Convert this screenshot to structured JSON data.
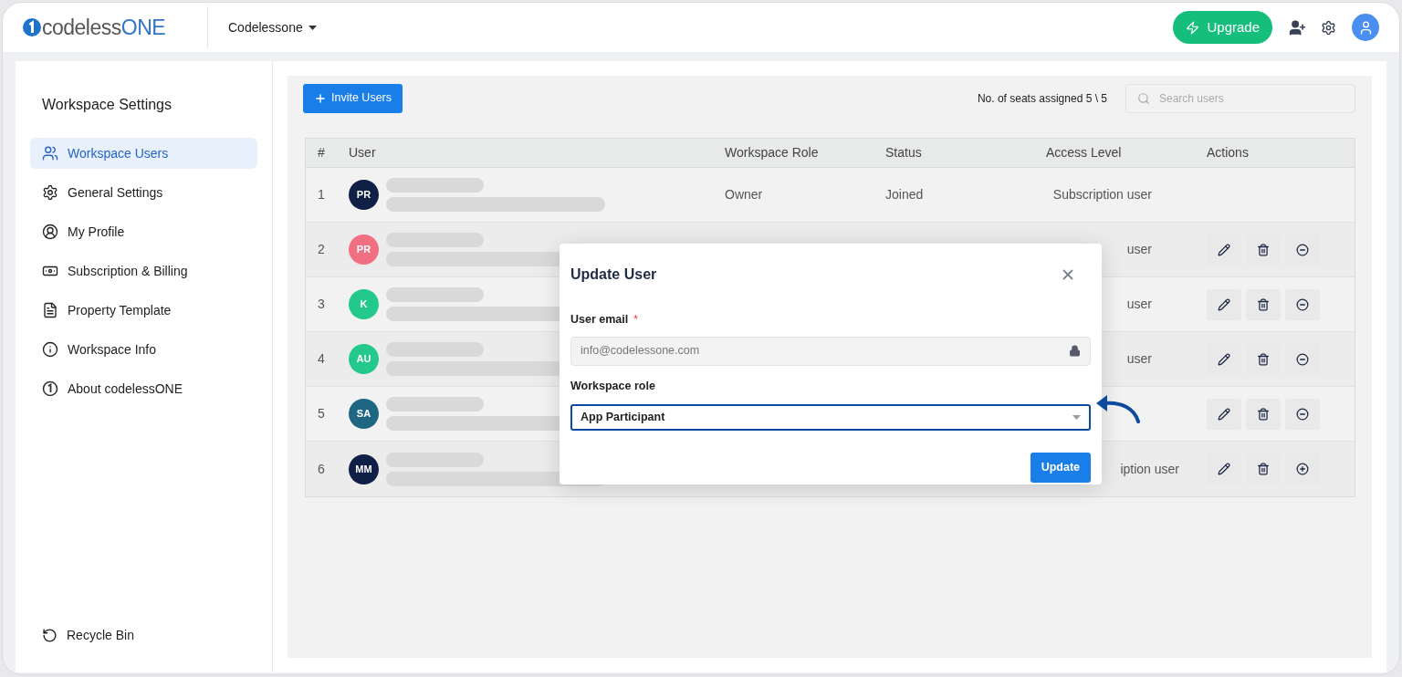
{
  "header": {
    "logo": {
      "prefix": "codeless",
      "suffix": "ONE"
    },
    "workspace": "Codelessone",
    "upgrade": "Upgrade"
  },
  "sidebar": {
    "title": "Workspace Settings",
    "items": [
      {
        "label": "Workspace Users",
        "selected": true
      },
      {
        "label": "General Settings",
        "selected": false
      },
      {
        "label": "My Profile",
        "selected": false
      },
      {
        "label": "Subscription & Billing",
        "selected": false
      },
      {
        "label": "Property Template",
        "selected": false
      },
      {
        "label": "Workspace Info",
        "selected": false
      },
      {
        "label": "About codelessONE",
        "selected": false
      }
    ],
    "bottom_item": {
      "label": "Recycle Bin"
    }
  },
  "toolbar": {
    "invite": "Invite Users",
    "seats": "No. of seats assigned 5 \\ 5",
    "search": {
      "placeholder": "Search users"
    }
  },
  "table": {
    "columns": [
      "#",
      "User",
      "Workspace Role",
      "Status",
      "Access Level",
      "Actions"
    ],
    "rows": [
      {
        "index": "1",
        "initials": "PR",
        "color": "#0f1f45",
        "role": "Owner",
        "status": "Joined",
        "access": "Subscription user",
        "actions": []
      },
      {
        "index": "2",
        "initials": "PR",
        "color": "#f06f80",
        "access": "user",
        "actions": [
          {
            "kind": "edit"
          },
          {
            "kind": "delete"
          },
          {
            "kind": "remove"
          }
        ]
      },
      {
        "index": "3",
        "initials": "K",
        "color": "#22c98a",
        "access": "user",
        "actions": [
          {
            "kind": "edit"
          },
          {
            "kind": "delete"
          },
          {
            "kind": "remove"
          }
        ]
      },
      {
        "index": "4",
        "initials": "AU",
        "color": "#22c98a",
        "access": "user",
        "actions": [
          {
            "kind": "edit"
          },
          {
            "kind": "delete"
          },
          {
            "kind": "remove"
          }
        ]
      },
      {
        "index": "5",
        "initials": "SA",
        "color": "#1f6683",
        "actions": [
          {
            "kind": "edit"
          },
          {
            "kind": "delete"
          },
          {
            "kind": "remove"
          }
        ]
      },
      {
        "index": "6",
        "initials": "MM",
        "color": "#0f1f45",
        "access": "iption user",
        "actions": [
          {
            "kind": "edit"
          },
          {
            "kind": "delete"
          },
          {
            "kind": "add"
          }
        ]
      }
    ]
  },
  "dialog": {
    "title": "Update User",
    "email_label": "User email",
    "email_required": "*",
    "email_value": "info@codelessone.com",
    "role_label": "Workspace role",
    "role_value": "App Participant",
    "submit": "Update"
  }
}
